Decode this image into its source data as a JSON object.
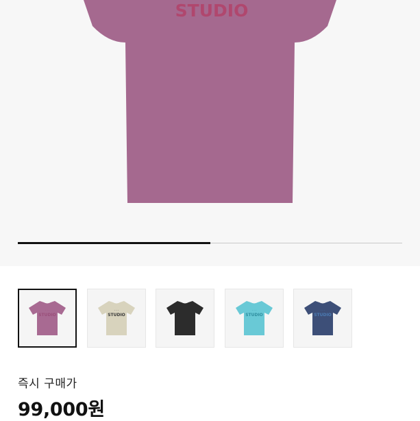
{
  "product": {
    "hero_shirt_text": "STUDIO",
    "hero_shirt_color": "#a5698f",
    "hero_text_color": "#b0476e",
    "gallery_progress": 0.5
  },
  "thumbnails": [
    {
      "name": "thumb-mauve",
      "color": "#a86a92",
      "text_color": "#9a4f7a",
      "text": "STUDIO",
      "selected": true
    },
    {
      "name": "thumb-beige",
      "color": "#d8d3bd",
      "text_color": "#3a3a3a",
      "text": "STUDIO",
      "selected": false
    },
    {
      "name": "thumb-black",
      "color": "#2c2c2c",
      "text_color": "#3a3a3a",
      "text": "",
      "selected": false
    },
    {
      "name": "thumb-aqua",
      "color": "#69c9d6",
      "text_color": "#2f8fa0",
      "text": "STUDIO",
      "selected": false
    },
    {
      "name": "thumb-navy",
      "color": "#3d4f78",
      "text_color": "#4b7bb3",
      "text": "STUDIO",
      "selected": false
    }
  ],
  "purchase": {
    "label": "즉시 구매가",
    "price": "99,000원"
  }
}
